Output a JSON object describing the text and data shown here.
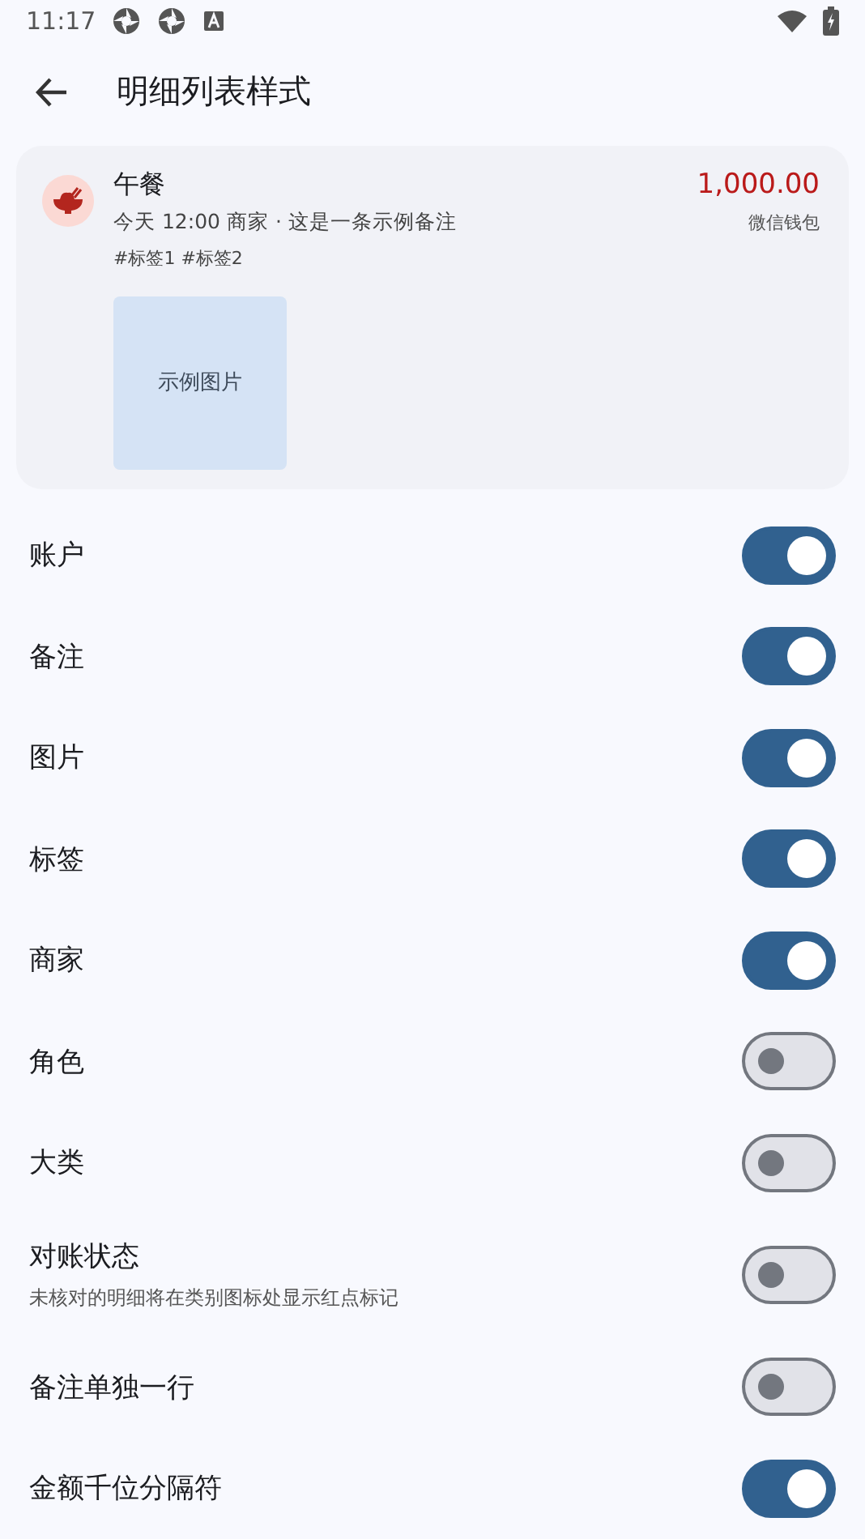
{
  "status_bar": {
    "time": "11:17"
  },
  "header": {
    "title": "明细列表样式"
  },
  "preview": {
    "category": "午餐",
    "detail": "今天 12:00 商家 · 这是一条示例备注",
    "tags": "#标签1 #标签2",
    "amount": "1,000.00",
    "account": "微信钱包",
    "image_label": "示例图片"
  },
  "settings": [
    {
      "label": "账户",
      "on": true
    },
    {
      "label": "备注",
      "on": true
    },
    {
      "label": "图片",
      "on": true
    },
    {
      "label": "标签",
      "on": true
    },
    {
      "label": "商家",
      "on": true
    },
    {
      "label": "角色",
      "on": false
    },
    {
      "label": "大类",
      "on": false
    },
    {
      "label": "对账状态",
      "description": "未核对的明细将在类别图标处显示红点标记",
      "on": false
    },
    {
      "label": "备注单独一行",
      "on": false
    },
    {
      "label": "金额千位分隔符",
      "on": true
    }
  ]
}
